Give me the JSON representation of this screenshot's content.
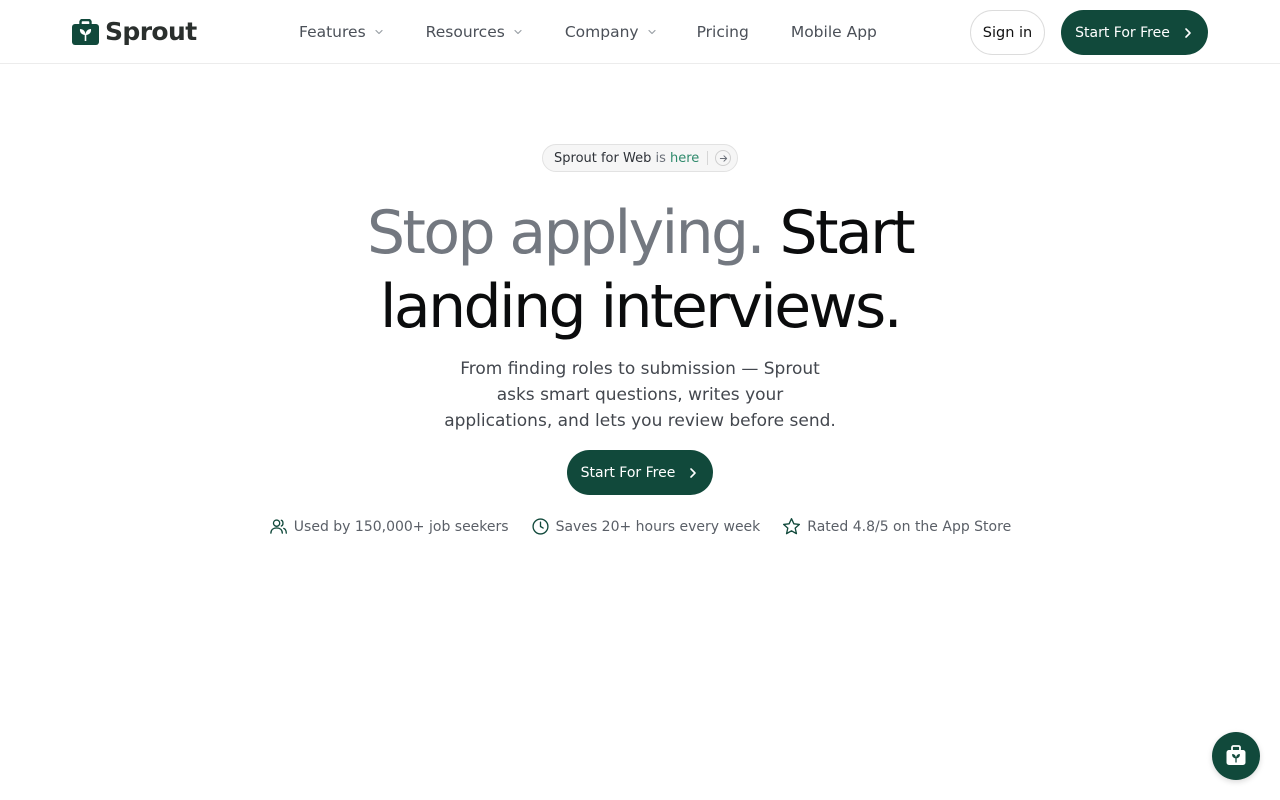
{
  "brand": {
    "name": "Sprout",
    "color": "#11493b",
    "icon": "briefcase-sprout-icon"
  },
  "nav": {
    "items": [
      {
        "label": "Features",
        "has_dropdown": true
      },
      {
        "label": "Resources",
        "has_dropdown": true
      },
      {
        "label": "Company",
        "has_dropdown": true
      },
      {
        "label": "Pricing",
        "has_dropdown": false
      },
      {
        "label": "Mobile App",
        "has_dropdown": false
      }
    ],
    "sign_in_label": "Sign in",
    "cta_label": "Start For Free"
  },
  "hero": {
    "announcement": {
      "part1": "Sprout for ",
      "part2": "Web",
      "part3": " is ",
      "part4": "here",
      "icon": "arrow-right-icon"
    },
    "headline": {
      "gray": "Stop applying.",
      "dark_line1": "Start",
      "dark_line2": "landing interviews."
    },
    "subtext": "From finding roles to submission — Sprout asks smart questions, writes your applications, and lets you review before send.",
    "cta_label": "Start For Free"
  },
  "stats": [
    {
      "icon": "users-icon",
      "text": "Used by 150,000+ job seekers"
    },
    {
      "icon": "clock-icon",
      "text": "Saves 20+ hours every week"
    },
    {
      "icon": "star-icon",
      "text": "Rated 4.8/5 on the App Store"
    }
  ],
  "chat_widget": {
    "icon": "briefcase-sprout-icon"
  }
}
